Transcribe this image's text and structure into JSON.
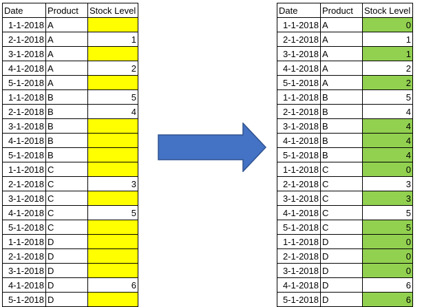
{
  "colors": {
    "empty_fill": "#ffff00",
    "filled_fill": "#92d050",
    "arrow_fill": "#4472c4",
    "arrow_stroke": "#2f528f"
  },
  "before": {
    "headers": [
      "Date",
      "Product",
      "Stock Level"
    ],
    "rows": [
      {
        "date": "1-1-2018",
        "product": "A",
        "stock": "",
        "highlight": true
      },
      {
        "date": "2-1-2018",
        "product": "A",
        "stock": "1",
        "highlight": false
      },
      {
        "date": "3-1-2018",
        "product": "A",
        "stock": "",
        "highlight": true
      },
      {
        "date": "4-1-2018",
        "product": "A",
        "stock": "2",
        "highlight": false
      },
      {
        "date": "5-1-2018",
        "product": "A",
        "stock": "",
        "highlight": true
      },
      {
        "date": "1-1-2018",
        "product": "B",
        "stock": "5",
        "highlight": false
      },
      {
        "date": "2-1-2018",
        "product": "B",
        "stock": "4",
        "highlight": false
      },
      {
        "date": "3-1-2018",
        "product": "B",
        "stock": "",
        "highlight": true
      },
      {
        "date": "4-1-2018",
        "product": "B",
        "stock": "",
        "highlight": true
      },
      {
        "date": "5-1-2018",
        "product": "B",
        "stock": "",
        "highlight": true
      },
      {
        "date": "1-1-2018",
        "product": "C",
        "stock": "",
        "highlight": true
      },
      {
        "date": "2-1-2018",
        "product": "C",
        "stock": "3",
        "highlight": false
      },
      {
        "date": "3-1-2018",
        "product": "C",
        "stock": "",
        "highlight": true
      },
      {
        "date": "4-1-2018",
        "product": "C",
        "stock": "5",
        "highlight": false
      },
      {
        "date": "5-1-2018",
        "product": "C",
        "stock": "",
        "highlight": true
      },
      {
        "date": "1-1-2018",
        "product": "D",
        "stock": "",
        "highlight": true
      },
      {
        "date": "2-1-2018",
        "product": "D",
        "stock": "",
        "highlight": true
      },
      {
        "date": "3-1-2018",
        "product": "D",
        "stock": "",
        "highlight": true
      },
      {
        "date": "4-1-2018",
        "product": "D",
        "stock": "6",
        "highlight": false
      },
      {
        "date": "5-1-2018",
        "product": "D",
        "stock": "",
        "highlight": true
      }
    ]
  },
  "after": {
    "headers": [
      "Date",
      "Product",
      "Stock Level"
    ],
    "rows": [
      {
        "date": "1-1-2018",
        "product": "A",
        "stock": "0",
        "highlight": true
      },
      {
        "date": "2-1-2018",
        "product": "A",
        "stock": "1",
        "highlight": false
      },
      {
        "date": "3-1-2018",
        "product": "A",
        "stock": "1",
        "highlight": true
      },
      {
        "date": "4-1-2018",
        "product": "A",
        "stock": "2",
        "highlight": false
      },
      {
        "date": "5-1-2018",
        "product": "A",
        "stock": "2",
        "highlight": true
      },
      {
        "date": "1-1-2018",
        "product": "B",
        "stock": "5",
        "highlight": false
      },
      {
        "date": "2-1-2018",
        "product": "B",
        "stock": "4",
        "highlight": false
      },
      {
        "date": "3-1-2018",
        "product": "B",
        "stock": "4",
        "highlight": true
      },
      {
        "date": "4-1-2018",
        "product": "B",
        "stock": "4",
        "highlight": true
      },
      {
        "date": "5-1-2018",
        "product": "B",
        "stock": "4",
        "highlight": true
      },
      {
        "date": "1-1-2018",
        "product": "C",
        "stock": "0",
        "highlight": true
      },
      {
        "date": "2-1-2018",
        "product": "C",
        "stock": "3",
        "highlight": false
      },
      {
        "date": "3-1-2018",
        "product": "C",
        "stock": "3",
        "highlight": true
      },
      {
        "date": "4-1-2018",
        "product": "C",
        "stock": "5",
        "highlight": false
      },
      {
        "date": "5-1-2018",
        "product": "C",
        "stock": "5",
        "highlight": true
      },
      {
        "date": "1-1-2018",
        "product": "D",
        "stock": "0",
        "highlight": true
      },
      {
        "date": "2-1-2018",
        "product": "D",
        "stock": "0",
        "highlight": true
      },
      {
        "date": "3-1-2018",
        "product": "D",
        "stock": "0",
        "highlight": true
      },
      {
        "date": "4-1-2018",
        "product": "D",
        "stock": "6",
        "highlight": false
      },
      {
        "date": "5-1-2018",
        "product": "D",
        "stock": "6",
        "highlight": true
      }
    ]
  },
  "arrow_icon": "right-arrow-icon"
}
